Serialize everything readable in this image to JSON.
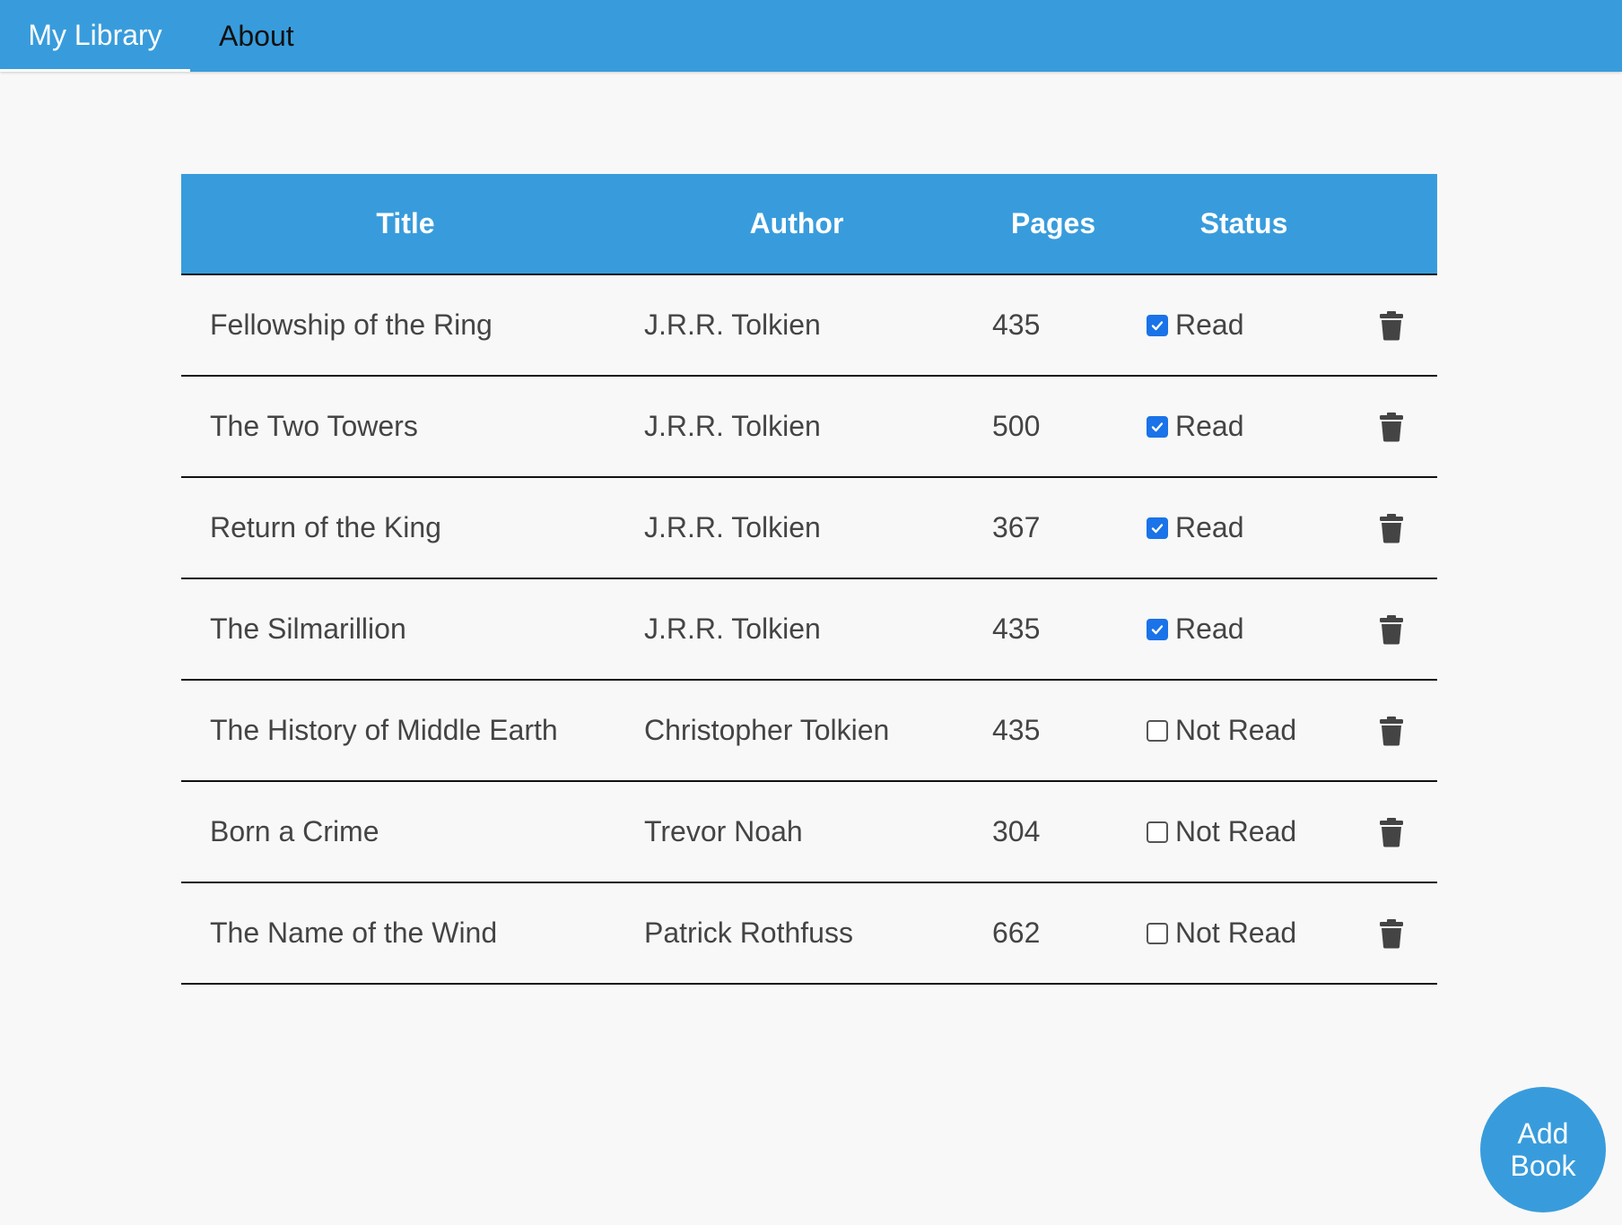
{
  "nav": {
    "tabs": [
      {
        "label": "My Library",
        "active": true
      },
      {
        "label": "About",
        "active": false
      }
    ]
  },
  "table": {
    "headers": [
      "Title",
      "Author",
      "Pages",
      "Status",
      ""
    ],
    "rows": [
      {
        "title": "Fellowship of the Ring",
        "author": "J.R.R. Tolkien",
        "pages": "435",
        "read": true,
        "status": "Read"
      },
      {
        "title": "The Two Towers",
        "author": "J.R.R. Tolkien",
        "pages": "500",
        "read": true,
        "status": "Read"
      },
      {
        "title": "Return of the King",
        "author": "J.R.R. Tolkien",
        "pages": "367",
        "read": true,
        "status": "Read"
      },
      {
        "title": "The Silmarillion",
        "author": "J.R.R. Tolkien",
        "pages": "435",
        "read": true,
        "status": "Read"
      },
      {
        "title": "The History of Middle Earth",
        "author": "Christopher Tolkien",
        "pages": "435",
        "read": false,
        "status": "Not Read"
      },
      {
        "title": "Born a Crime",
        "author": "Trevor Noah",
        "pages": "304",
        "read": false,
        "status": "Not Read"
      },
      {
        "title": "The Name of the Wind",
        "author": "Patrick Rothfuss",
        "pages": "662",
        "read": false,
        "status": "Not Read"
      }
    ]
  },
  "add_button": {
    "line1": "Add",
    "line2": "Book"
  },
  "colors": {
    "accent": "#389cdc",
    "checkbox": "#1a73e8",
    "text": "#444444",
    "background": "#f8f8f8"
  },
  "icons": {
    "delete": "trash-icon",
    "checked": "checkbox-checked-icon",
    "unchecked": "checkbox-unchecked-icon"
  }
}
